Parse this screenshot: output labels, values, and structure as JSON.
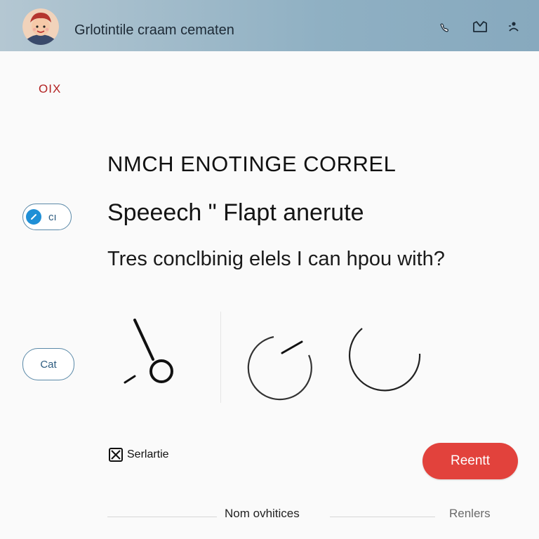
{
  "header": {
    "title": "Grlotintile craam cematen",
    "icons": [
      "phone-icon",
      "mail-icon",
      "person-icon"
    ]
  },
  "top_link": "OIX",
  "main": {
    "heading": "NMCH ENOTINGE CORREL",
    "subheading": "Speeech \" Flapt anerute",
    "prompt": "Tres conclbinig elels I can hpou with?"
  },
  "side": {
    "toggle_label": "cı",
    "cat_label": "Cat"
  },
  "footer_actions": {
    "checkbox_label": "Serlartie",
    "checkbox_checked": true,
    "primary_button": "Reentt",
    "center_link": "Nom ovhitices",
    "right_link": "Renlers"
  },
  "colors": {
    "accent": "#e2423c",
    "header_bg": "#8fb0c3",
    "toggle_dot": "#1f8fd6",
    "link_red": "#b22222"
  }
}
